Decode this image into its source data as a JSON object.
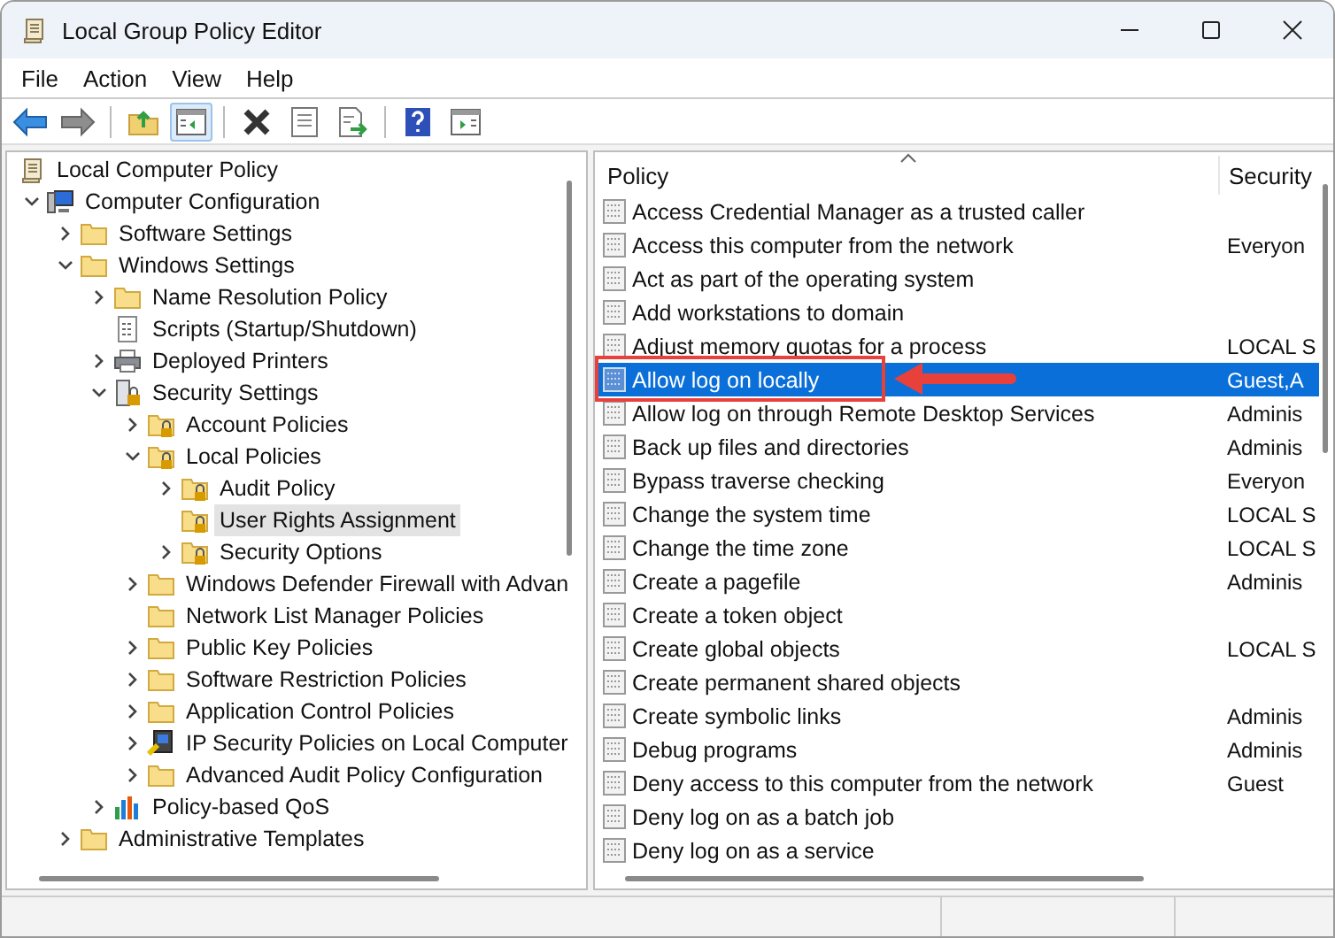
{
  "window": {
    "title": "Local Group Policy Editor"
  },
  "menu": [
    "File",
    "Action",
    "View",
    "Help"
  ],
  "toolbar": {
    "groups": [
      [
        {
          "kind": "back",
          "pressed": false
        },
        {
          "kind": "forward",
          "pressed": false
        }
      ],
      [
        {
          "kind": "up",
          "pressed": false
        },
        {
          "kind": "tree",
          "pressed": true
        }
      ],
      [
        {
          "kind": "delete",
          "pressed": false
        },
        {
          "kind": "properties",
          "pressed": false
        },
        {
          "kind": "export",
          "pressed": false
        }
      ],
      [
        {
          "kind": "help",
          "pressed": false
        },
        {
          "kind": "actionpane",
          "pressed": false
        }
      ]
    ]
  },
  "tree": {
    "label": "Local Computer Policy",
    "kind": "policy",
    "selected": false,
    "children": [
      {
        "label": "Computer Configuration",
        "kind": "computer",
        "expandable": true,
        "expanded": true,
        "selected": false,
        "children": [
          {
            "label": "Software Settings",
            "kind": "folder",
            "expandable": true,
            "expanded": false,
            "selected": false
          },
          {
            "label": "Windows Settings",
            "kind": "folder",
            "expandable": true,
            "expanded": true,
            "selected": false,
            "children": [
              {
                "label": "Name Resolution Policy",
                "kind": "folder",
                "expandable": true,
                "expanded": false,
                "selected": false
              },
              {
                "label": "Scripts (Startup/Shutdown)",
                "kind": "script",
                "expandable": false,
                "selected": false
              },
              {
                "label": "Deployed Printers",
                "kind": "printer",
                "expandable": true,
                "expanded": false,
                "selected": false
              },
              {
                "label": "Security Settings",
                "kind": "security",
                "expandable": true,
                "expanded": true,
                "selected": false,
                "children": [
                  {
                    "label": "Account Policies",
                    "kind": "lockfolder",
                    "expandable": true,
                    "expanded": false,
                    "selected": false
                  },
                  {
                    "label": "Local Policies",
                    "kind": "lockfolder",
                    "expandable": true,
                    "expanded": true,
                    "selected": false,
                    "children": [
                      {
                        "label": "Audit Policy",
                        "kind": "lockfolder",
                        "expandable": true,
                        "expanded": false,
                        "selected": false
                      },
                      {
                        "label": "User Rights Assignment",
                        "kind": "lockfolder",
                        "expandable": false,
                        "selected": true
                      },
                      {
                        "label": "Security Options",
                        "kind": "lockfolder",
                        "expandable": true,
                        "expanded": false,
                        "selected": false
                      }
                    ]
                  },
                  {
                    "label": "Windows Defender Firewall with Advan",
                    "kind": "folder",
                    "expandable": true,
                    "expanded": false,
                    "selected": false
                  },
                  {
                    "label": "Network List Manager Policies",
                    "kind": "folder",
                    "expandable": false,
                    "selected": false
                  },
                  {
                    "label": "Public Key Policies",
                    "kind": "folder",
                    "expandable": true,
                    "expanded": false,
                    "selected": false
                  },
                  {
                    "label": "Software Restriction Policies",
                    "kind": "folder",
                    "expandable": true,
                    "expanded": false,
                    "selected": false
                  },
                  {
                    "label": "Application Control Policies",
                    "kind": "folder",
                    "expandable": true,
                    "expanded": false,
                    "selected": false
                  },
                  {
                    "label": "IP Security Policies on Local Computer",
                    "kind": "ipsec",
                    "expandable": true,
                    "expanded": false,
                    "selected": false
                  },
                  {
                    "label": "Advanced Audit Policy Configuration",
                    "kind": "folder",
                    "expandable": true,
                    "expanded": false,
                    "selected": false
                  }
                ]
              },
              {
                "label": "Policy-based QoS",
                "kind": "chart",
                "expandable": true,
                "expanded": false,
                "selected": false
              }
            ]
          },
          {
            "label": "Administrative Templates",
            "kind": "folder",
            "expandable": true,
            "expanded": false,
            "selected": false
          }
        ]
      }
    ]
  },
  "table": {
    "columns": [
      {
        "label": "Policy",
        "sorted": true
      },
      {
        "label": "Security",
        "sorted": false
      }
    ],
    "rows": [
      {
        "policy": "Access Credential Manager as a trusted caller",
        "selected": false
      },
      {
        "policy": "Access this computer from the network",
        "setting": "Everyon",
        "selected": false
      },
      {
        "policy": "Act as part of the operating system",
        "selected": false
      },
      {
        "policy": "Add workstations to domain",
        "selected": false
      },
      {
        "policy": "Adjust memory quotas for a process",
        "setting": "LOCAL S",
        "selected": false
      },
      {
        "policy": "Allow log on locally",
        "setting": "Guest,A",
        "selected": true
      },
      {
        "policy": "Allow log on through Remote Desktop Services",
        "setting": "Adminis",
        "selected": false
      },
      {
        "policy": "Back up files and directories",
        "setting": "Adminis",
        "selected": false
      },
      {
        "policy": "Bypass traverse checking",
        "setting": "Everyon",
        "selected": false
      },
      {
        "policy": "Change the system time",
        "setting": "LOCAL S",
        "selected": false
      },
      {
        "policy": "Change the time zone",
        "setting": "LOCAL S",
        "selected": false
      },
      {
        "policy": "Create a pagefile",
        "setting": "Adminis",
        "selected": false
      },
      {
        "policy": "Create a token object",
        "selected": false
      },
      {
        "policy": "Create global objects",
        "setting": "LOCAL S",
        "selected": false
      },
      {
        "policy": "Create permanent shared objects",
        "selected": false
      },
      {
        "policy": "Create symbolic links",
        "setting": "Adminis",
        "selected": false
      },
      {
        "policy": "Debug programs",
        "setting": "Adminis",
        "selected": false
      },
      {
        "policy": "Deny access to this computer from the network",
        "setting": "Guest",
        "selected": false
      },
      {
        "policy": "Deny log on as a batch job",
        "selected": false
      },
      {
        "policy": "Deny log on as a service",
        "selected": false
      }
    ]
  }
}
